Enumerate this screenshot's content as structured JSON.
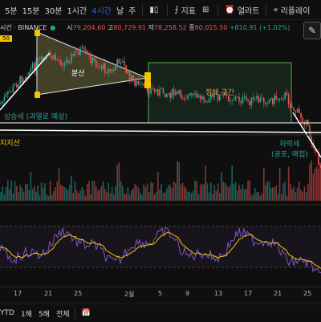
{
  "toolbar": {
    "timeframes": [
      "5분",
      "15분",
      "30분",
      "1시간",
      "4시간",
      "날",
      "주"
    ],
    "active_timeframe": "4시간",
    "indicators_label": "지표",
    "alert_label": "얼러트",
    "replay_label": "리플레이"
  },
  "symbol": {
    "title": "시간 · BINANCE",
    "open_k": "시",
    "open_v": "79,204.60",
    "high_k": "고",
    "high_v": "80,729.91",
    "low_k": "저",
    "low_v": "78,258.52",
    "close_k": "종",
    "close_v": "80,015.50",
    "change": "+810.91 (+1.02%)",
    "price_badge": "50"
  },
  "annotations": {
    "divergence": "분산",
    "consolidation": "정체 구간",
    "uptrend": "상승세 (과열로 예상)",
    "support": "지지선",
    "downtrend_line1": "하락세",
    "downtrend_line2": "(공포, 매집)"
  },
  "x_axis": [
    "17",
    "21",
    "25",
    "2월",
    "5",
    "9",
    "13",
    "17",
    "21",
    "25"
  ],
  "bottombar": {
    "ytd": "YTD",
    "one_year": "1해",
    "five_year": "5해",
    "all": "전체"
  },
  "colors": {
    "accent": "#2962ff",
    "up": "#26a69a",
    "down": "#ef5350",
    "highlight": "#f5c400",
    "box": "#4caf50",
    "oscillator": "#7e57c2",
    "signal": "#f5c400"
  }
}
